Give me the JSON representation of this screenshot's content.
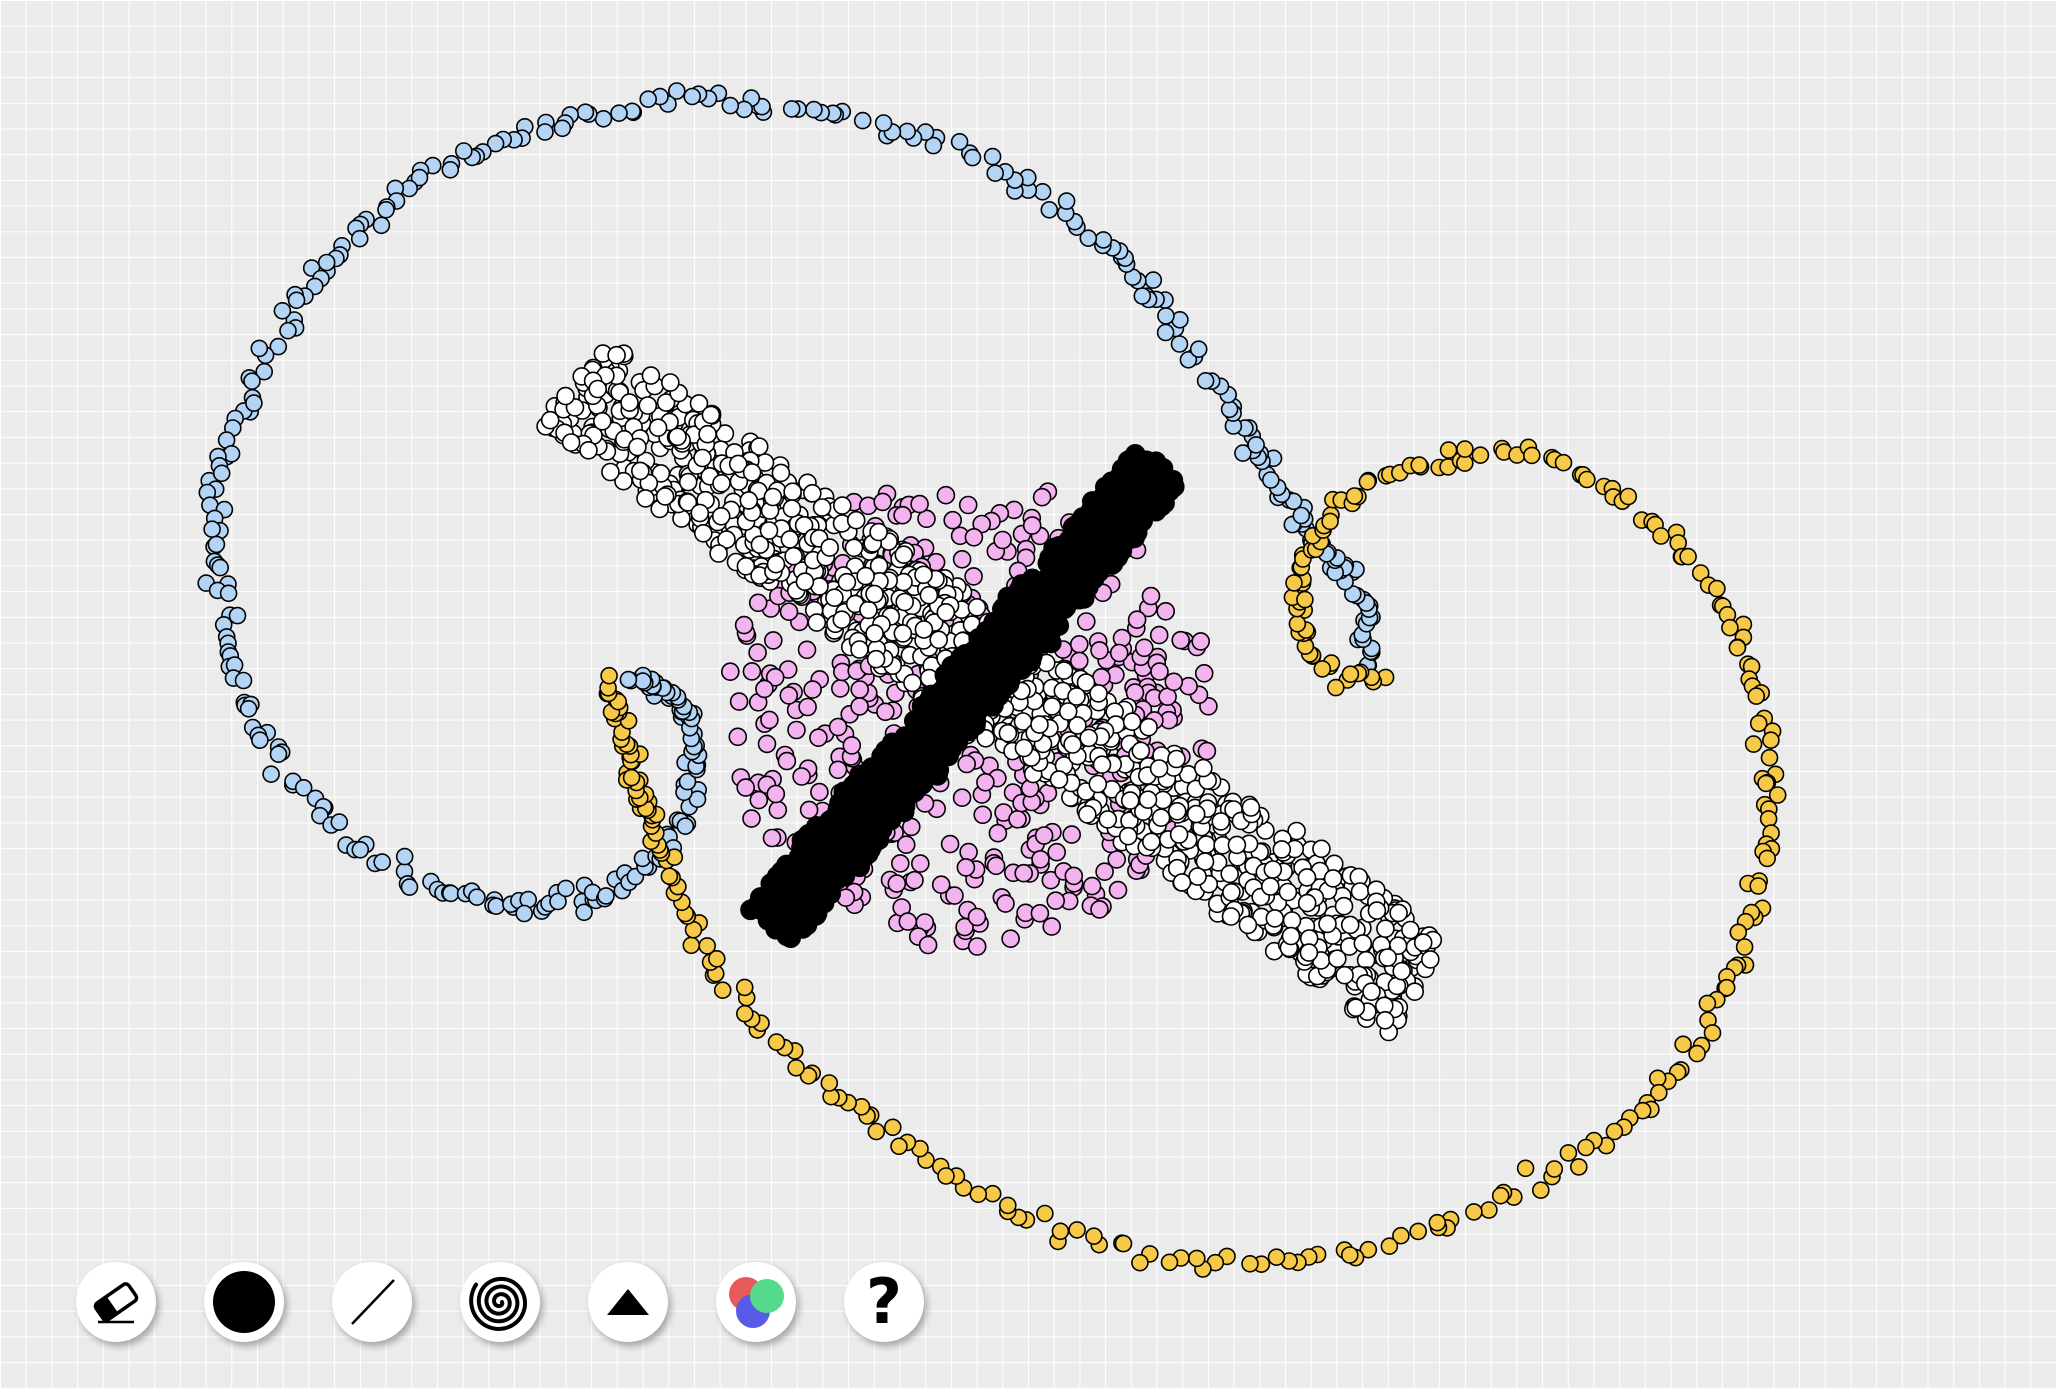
{
  "canvas": {
    "background": "#ebebeb",
    "grid_color": "#ffffff",
    "point_outline": "#000000"
  },
  "clusters": [
    {
      "name": "blue-spiral",
      "color": "#b3d4f5",
      "shape": "spiral"
    },
    {
      "name": "yellow-spiral",
      "color": "#f7c948",
      "shape": "spiral"
    },
    {
      "name": "white-bar",
      "color": "#ffffff",
      "shape": "bar"
    },
    {
      "name": "pink-blob",
      "color": "#f2b3ef",
      "shape": "blob"
    },
    {
      "name": "black-bar",
      "color": "#000000",
      "shape": "bar"
    }
  ],
  "toolbar": {
    "items": [
      {
        "name": "eraser-tool",
        "icon": "eraser-icon"
      },
      {
        "name": "point-tool",
        "icon": "filled-circle-icon"
      },
      {
        "name": "line-tool",
        "icon": "line-icon"
      },
      {
        "name": "spiral-tool",
        "icon": "spiral-icon"
      },
      {
        "name": "triangle-tool",
        "icon": "triangle-icon"
      },
      {
        "name": "color-mix-tool",
        "icon": "color-circles-icon",
        "colors": [
          "#e85a5a",
          "#55d98a",
          "#5a5ae8"
        ]
      },
      {
        "name": "help-button",
        "icon": "question-mark-icon",
        "label": "?"
      }
    ]
  }
}
